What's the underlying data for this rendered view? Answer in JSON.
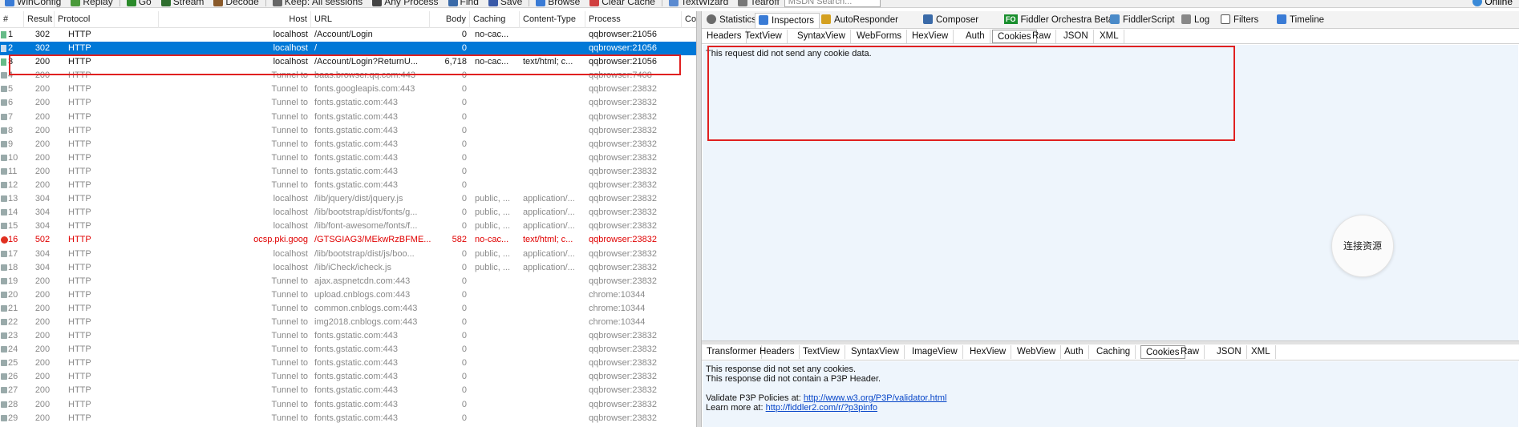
{
  "toolbar": {
    "items": [
      {
        "label": "WinConfig",
        "icon": "winconfig-icon",
        "color": "#3a7bd5"
      },
      {
        "label": "Replay",
        "icon": "replay-icon",
        "color": "#4a9a3a"
      },
      {
        "label": "Go",
        "icon": "go-icon",
        "color": "#2a8a2a"
      },
      {
        "label": "Stream",
        "icon": "stream-icon",
        "color": "#2f6e2f"
      },
      {
        "label": "Decode",
        "icon": "decode-icon",
        "color": "#8a5a2a"
      },
      {
        "label": "Keep: All sessions",
        "icon": "keep-icon",
        "color": "#666666"
      },
      {
        "label": "Any Process",
        "icon": "process-icon",
        "color": "#444444"
      },
      {
        "label": "Find",
        "icon": "find-icon",
        "color": "#3a6aa8"
      },
      {
        "label": "Save",
        "icon": "save-icon",
        "color": "#3a5aa8"
      },
      {
        "label": "Browse",
        "icon": "browse-icon",
        "color": "#3a7bd5"
      },
      {
        "label": "Clear Cache",
        "icon": "clear-cache-icon",
        "color": "#d04040"
      },
      {
        "label": "TextWizard",
        "icon": "textwizard-icon",
        "color": "#5a8ad0"
      },
      {
        "label": "Tearoff",
        "icon": "tearoff-icon",
        "color": "#777777"
      }
    ],
    "search_placeholder": "MSDN Search...",
    "online_label": "Online"
  },
  "grid": {
    "columns": [
      "#",
      "Result",
      "Protocol",
      "Host",
      "URL",
      "Body",
      "Caching",
      "Content-Type",
      "Process",
      "Co"
    ],
    "rows": [
      {
        "num": "1",
        "result": "302",
        "protocol": "HTTP",
        "host": "localhost",
        "url": "/Account/Login",
        "body": "0",
        "caching": "no-cac...",
        "ctype": "",
        "process": "qqbrowser:21056",
        "style": "dark",
        "icon": "arrow"
      },
      {
        "num": "2",
        "result": "302",
        "protocol": "HTTP",
        "host": "localhost",
        "url": "/",
        "body": "0",
        "caching": "",
        "ctype": "",
        "process": "qqbrowser:21056",
        "style": "selected",
        "icon": "arrow"
      },
      {
        "num": "3",
        "result": "200",
        "protocol": "HTTP",
        "host": "localhost",
        "url": "/Account/Login?ReturnU...",
        "body": "6,718",
        "caching": "no-cac...",
        "ctype": "text/html; c...",
        "process": "qqbrowser:21056",
        "style": "dark",
        "icon": "arrow"
      },
      {
        "num": "4",
        "result": "200",
        "protocol": "HTTP",
        "host": "Tunnel to",
        "url": "baas.browser.qq.com:443",
        "body": "0",
        "caching": "",
        "ctype": "",
        "process": "qqbrowser:7408",
        "style": "",
        "icon": "lock"
      },
      {
        "num": "5",
        "result": "200",
        "protocol": "HTTP",
        "host": "Tunnel to",
        "url": "fonts.googleapis.com:443",
        "body": "0",
        "caching": "",
        "ctype": "",
        "process": "qqbrowser:23832",
        "style": "",
        "icon": "lock"
      },
      {
        "num": "6",
        "result": "200",
        "protocol": "HTTP",
        "host": "Tunnel to",
        "url": "fonts.gstatic.com:443",
        "body": "0",
        "caching": "",
        "ctype": "",
        "process": "qqbrowser:23832",
        "style": "",
        "icon": "lock"
      },
      {
        "num": "7",
        "result": "200",
        "protocol": "HTTP",
        "host": "Tunnel to",
        "url": "fonts.gstatic.com:443",
        "body": "0",
        "caching": "",
        "ctype": "",
        "process": "qqbrowser:23832",
        "style": "",
        "icon": "lock"
      },
      {
        "num": "8",
        "result": "200",
        "protocol": "HTTP",
        "host": "Tunnel to",
        "url": "fonts.gstatic.com:443",
        "body": "0",
        "caching": "",
        "ctype": "",
        "process": "qqbrowser:23832",
        "style": "",
        "icon": "lock"
      },
      {
        "num": "9",
        "result": "200",
        "protocol": "HTTP",
        "host": "Tunnel to",
        "url": "fonts.gstatic.com:443",
        "body": "0",
        "caching": "",
        "ctype": "",
        "process": "qqbrowser:23832",
        "style": "",
        "icon": "lock"
      },
      {
        "num": "10",
        "result": "200",
        "protocol": "HTTP",
        "host": "Tunnel to",
        "url": "fonts.gstatic.com:443",
        "body": "0",
        "caching": "",
        "ctype": "",
        "process": "qqbrowser:23832",
        "style": "",
        "icon": "lock"
      },
      {
        "num": "11",
        "result": "200",
        "protocol": "HTTP",
        "host": "Tunnel to",
        "url": "fonts.gstatic.com:443",
        "body": "0",
        "caching": "",
        "ctype": "",
        "process": "qqbrowser:23832",
        "style": "",
        "icon": "lock"
      },
      {
        "num": "12",
        "result": "200",
        "protocol": "HTTP",
        "host": "Tunnel to",
        "url": "fonts.gstatic.com:443",
        "body": "0",
        "caching": "",
        "ctype": "",
        "process": "qqbrowser:23832",
        "style": "",
        "icon": "lock"
      },
      {
        "num": "13",
        "result": "304",
        "protocol": "HTTP",
        "host": "localhost",
        "url": "/lib/jquery/dist/jquery.js",
        "body": "0",
        "caching": "public, ...",
        "ctype": "application/...",
        "process": "qqbrowser:23832",
        "style": "",
        "icon": "diamond"
      },
      {
        "num": "14",
        "result": "304",
        "protocol": "HTTP",
        "host": "localhost",
        "url": "/lib/bootstrap/dist/fonts/g...",
        "body": "0",
        "caching": "public, ...",
        "ctype": "application/...",
        "process": "qqbrowser:23832",
        "style": "",
        "icon": "diamond"
      },
      {
        "num": "15",
        "result": "304",
        "protocol": "HTTP",
        "host": "localhost",
        "url": "/lib/font-awesome/fonts/f...",
        "body": "0",
        "caching": "public, ...",
        "ctype": "application/...",
        "process": "qqbrowser:23832",
        "style": "",
        "icon": "diamond"
      },
      {
        "num": "16",
        "result": "502",
        "protocol": "HTTP",
        "host": "ocsp.pki.goog",
        "url": "/GTSGIAG3/MEkwRzBFME...",
        "body": "582",
        "caching": "no-cac...",
        "ctype": "text/html; c...",
        "process": "qqbrowser:23832",
        "style": "error",
        "icon": "err"
      },
      {
        "num": "17",
        "result": "304",
        "protocol": "HTTP",
        "host": "localhost",
        "url": "/lib/bootstrap/dist/js/boo...",
        "body": "0",
        "caching": "public, ...",
        "ctype": "application/...",
        "process": "qqbrowser:23832",
        "style": "",
        "icon": "diamond"
      },
      {
        "num": "18",
        "result": "304",
        "protocol": "HTTP",
        "host": "localhost",
        "url": "/lib/iCheck/icheck.js",
        "body": "0",
        "caching": "public, ...",
        "ctype": "application/...",
        "process": "qqbrowser:23832",
        "style": "",
        "icon": "diamond"
      },
      {
        "num": "19",
        "result": "200",
        "protocol": "HTTP",
        "host": "Tunnel to",
        "url": "ajax.aspnetcdn.com:443",
        "body": "0",
        "caching": "",
        "ctype": "",
        "process": "qqbrowser:23832",
        "style": "",
        "icon": "lock"
      },
      {
        "num": "20",
        "result": "200",
        "protocol": "HTTP",
        "host": "Tunnel to",
        "url": "upload.cnblogs.com:443",
        "body": "0",
        "caching": "",
        "ctype": "",
        "process": "chrome:10344",
        "style": "",
        "icon": "lock"
      },
      {
        "num": "21",
        "result": "200",
        "protocol": "HTTP",
        "host": "Tunnel to",
        "url": "common.cnblogs.com:443",
        "body": "0",
        "caching": "",
        "ctype": "",
        "process": "chrome:10344",
        "style": "",
        "icon": "lock"
      },
      {
        "num": "22",
        "result": "200",
        "protocol": "HTTP",
        "host": "Tunnel to",
        "url": "img2018.cnblogs.com:443",
        "body": "0",
        "caching": "",
        "ctype": "",
        "process": "chrome:10344",
        "style": "",
        "icon": "lock"
      },
      {
        "num": "23",
        "result": "200",
        "protocol": "HTTP",
        "host": "Tunnel to",
        "url": "fonts.gstatic.com:443",
        "body": "0",
        "caching": "",
        "ctype": "",
        "process": "qqbrowser:23832",
        "style": "",
        "icon": "lock"
      },
      {
        "num": "24",
        "result": "200",
        "protocol": "HTTP",
        "host": "Tunnel to",
        "url": "fonts.gstatic.com:443",
        "body": "0",
        "caching": "",
        "ctype": "",
        "process": "qqbrowser:23832",
        "style": "",
        "icon": "lock"
      },
      {
        "num": "25",
        "result": "200",
        "protocol": "HTTP",
        "host": "Tunnel to",
        "url": "fonts.gstatic.com:443",
        "body": "0",
        "caching": "",
        "ctype": "",
        "process": "qqbrowser:23832",
        "style": "",
        "icon": "lock"
      },
      {
        "num": "26",
        "result": "200",
        "protocol": "HTTP",
        "host": "Tunnel to",
        "url": "fonts.gstatic.com:443",
        "body": "0",
        "caching": "",
        "ctype": "",
        "process": "qqbrowser:23832",
        "style": "",
        "icon": "lock"
      },
      {
        "num": "27",
        "result": "200",
        "protocol": "HTTP",
        "host": "Tunnel to",
        "url": "fonts.gstatic.com:443",
        "body": "0",
        "caching": "",
        "ctype": "",
        "process": "qqbrowser:23832",
        "style": "",
        "icon": "lock"
      },
      {
        "num": "28",
        "result": "200",
        "protocol": "HTTP",
        "host": "Tunnel to",
        "url": "fonts.gstatic.com:443",
        "body": "0",
        "caching": "",
        "ctype": "",
        "process": "qqbrowser:23832",
        "style": "",
        "icon": "lock"
      },
      {
        "num": "29",
        "result": "200",
        "protocol": "HTTP",
        "host": "Tunnel to",
        "url": "fonts.gstatic.com:443",
        "body": "0",
        "caching": "",
        "ctype": "",
        "process": "qqbrowser:23832",
        "style": "",
        "icon": "lock"
      }
    ]
  },
  "main_tabs": [
    {
      "label": "Statistics",
      "icon": "statistics-icon",
      "active": false
    },
    {
      "label": "Inspectors",
      "icon": "inspectors-icon",
      "active": true
    },
    {
      "label": "AutoResponder",
      "icon": "autoresponder-icon",
      "active": false
    },
    {
      "label": "Composer",
      "icon": "composer-icon",
      "active": false
    },
    {
      "label": "Fiddler Orchestra Beta",
      "icon": "fo-icon",
      "badge": "FO",
      "active": false
    },
    {
      "label": "FiddlerScript",
      "icon": "fiddlerscript-icon",
      "active": false
    },
    {
      "label": "Log",
      "icon": "log-icon",
      "active": false
    },
    {
      "label": "Filters",
      "icon": "filters-icon",
      "active": false
    },
    {
      "label": "Timeline",
      "icon": "timeline-icon",
      "active": false
    }
  ],
  "request_tabs": [
    {
      "label": "Headers",
      "active": false
    },
    {
      "label": "TextView",
      "active": false
    },
    {
      "label": "SyntaxView",
      "active": false
    },
    {
      "label": "WebForms",
      "active": false
    },
    {
      "label": "HexView",
      "active": false
    },
    {
      "label": "Auth",
      "active": false
    },
    {
      "label": "Cookies",
      "active": true
    },
    {
      "label": "Raw",
      "active": false
    },
    {
      "label": "JSON",
      "active": false
    },
    {
      "label": "XML",
      "active": false
    }
  ],
  "request_message": "This request did not send any cookie data.",
  "floating_button_label": "连接资源",
  "response_tabs": [
    {
      "label": "Transformer",
      "active": false
    },
    {
      "label": "Headers",
      "active": false
    },
    {
      "label": "TextView",
      "active": false
    },
    {
      "label": "SyntaxView",
      "active": false
    },
    {
      "label": "ImageView",
      "active": false
    },
    {
      "label": "HexView",
      "active": false
    },
    {
      "label": "WebView",
      "active": false
    },
    {
      "label": "Auth",
      "active": false
    },
    {
      "label": "Caching",
      "active": false
    },
    {
      "label": "Cookies",
      "active": true
    },
    {
      "label": "Raw",
      "active": false
    },
    {
      "label": "JSON",
      "active": false
    },
    {
      "label": "XML",
      "active": false
    }
  ],
  "response": {
    "line1": "This response did not set any cookies.",
    "line2": "This response did not contain a P3P Header.",
    "validate_label": "Validate P3P Policies at:",
    "validate_link": "http://www.w3.org/P3P/validator.html",
    "learn_label": "Learn more at:",
    "learn_link": "http://fiddler2.com/r/?p3pinfo"
  },
  "colors": {
    "selection": "#0078d7",
    "highlight_outline": "#e02020",
    "error_text": "#e00000",
    "inspector_bg": "#eef5fc"
  }
}
